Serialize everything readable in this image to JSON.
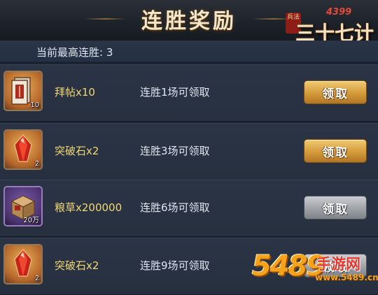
{
  "header": {
    "title": "连胜奖励",
    "logo": {
      "brand": "4399",
      "badge": "兵法",
      "name": "三十七计"
    }
  },
  "best_streak": {
    "label": "当前最高连胜: 3"
  },
  "rewards": [
    {
      "item": "拜帖x10",
      "count": "10",
      "condition": "连胜1场可领取",
      "button": "领取",
      "state": "active"
    },
    {
      "item": "突破石x2",
      "count": "2",
      "condition": "连胜3场可领取",
      "button": "领取",
      "state": "active"
    },
    {
      "item": "粮草x200000",
      "count": "20万",
      "condition": "连胜6场可领取",
      "button": "领取",
      "state": "disabled"
    },
    {
      "item": "突破石x2",
      "count": "2",
      "condition": "连胜9场可领取",
      "button": "领取",
      "state": "disabled"
    }
  ],
  "watermark": {
    "number": "5489",
    "site": "手游网",
    "url": "www.5489.cn"
  }
}
